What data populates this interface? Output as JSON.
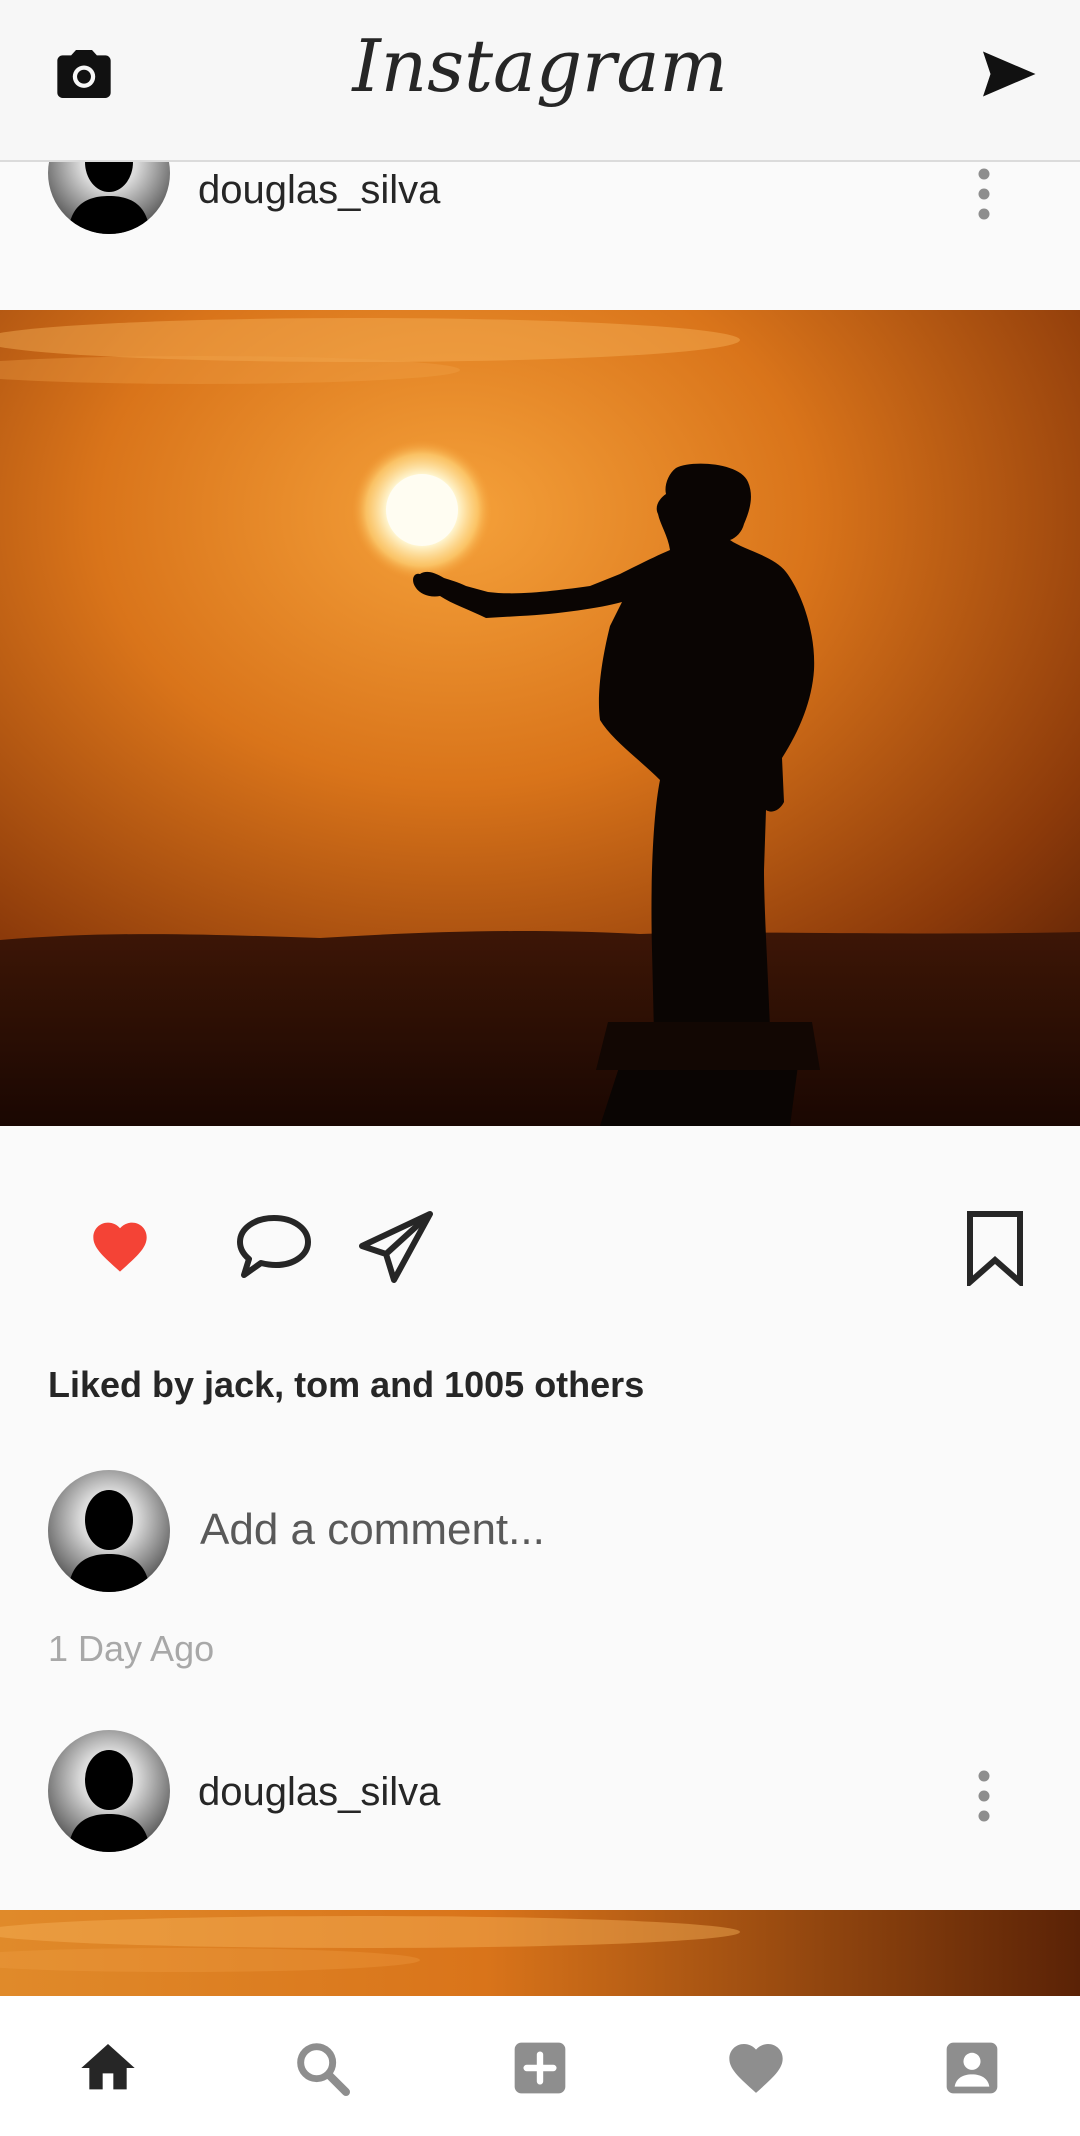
{
  "app": {
    "title": "Instagram"
  },
  "topbar": {
    "camera_icon": "camera-icon",
    "direct_icon": "send-icon"
  },
  "posts": [
    {
      "username": "douglas_silva",
      "liked_text": "Liked by jack, tom and 1005 others",
      "comment_placeholder": "Add a comment...",
      "time": "1 Day Ago",
      "liked": true
    },
    {
      "username": "douglas_silva"
    }
  ],
  "nav": {
    "items": [
      "home-icon",
      "search-icon",
      "add-icon",
      "heart-icon",
      "profile-icon"
    ]
  },
  "colors": {
    "like_red": "#f44336",
    "sunset_orange": "#d9771f",
    "icon_dark": "#262626",
    "icon_gray": "#8e8e8e"
  }
}
